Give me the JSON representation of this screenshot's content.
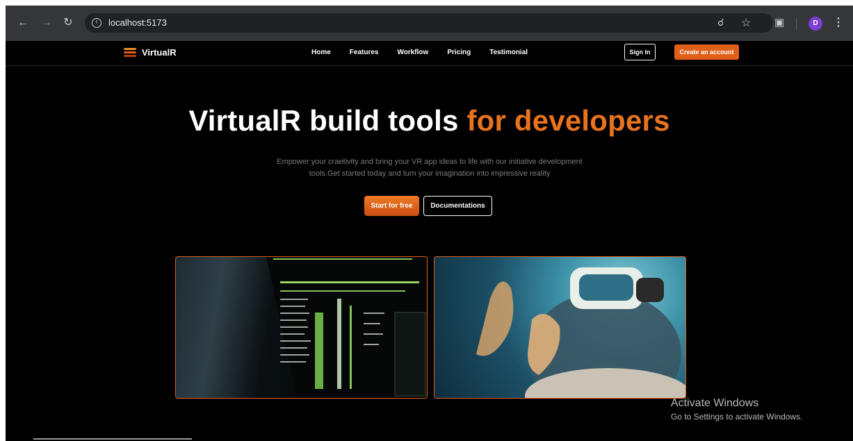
{
  "browser": {
    "url": "localhost:5173",
    "avatar_initial": "D"
  },
  "site": {
    "logo_text": "VirtualR",
    "nav": [
      "Home",
      "Features",
      "Workflow",
      "Pricing",
      "Testimonial"
    ],
    "sign_in": "Sign In",
    "create_account": "Create an account"
  },
  "hero": {
    "title_main": "VirtualR build tools",
    "title_accent": "for developers",
    "subtitle_line1": "Empower your craetivity and bring your VR app ideas to life with our initiative development",
    "subtitle_line2": "tools.Get started today and turn your imagination into impressive reality",
    "cta_primary": "Start for free",
    "cta_secondary": "Documentations"
  },
  "colors": {
    "accent": "#e0601a",
    "accent_text": "#e8731f",
    "background": "#000000"
  },
  "windows_watermark": {
    "line1": "Activate Windows",
    "line2": "Go to Settings to activate Windows."
  }
}
